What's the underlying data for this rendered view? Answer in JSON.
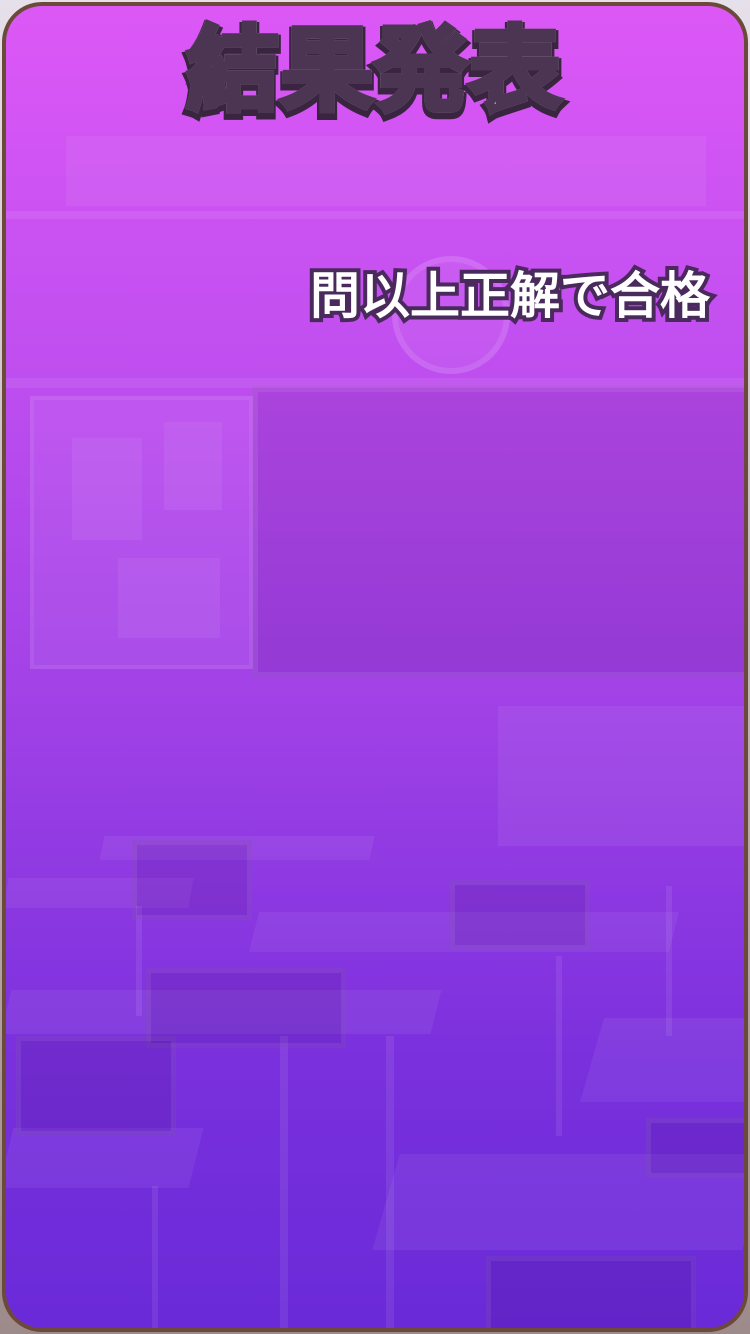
{
  "screen": {
    "title": "結果発表",
    "pass_rule": "問以上正解で合格"
  },
  "colors": {
    "panel_top": "#dc58f6",
    "panel_bottom": "#6a2ad8",
    "frame": "#6b4a3a",
    "title_outline": "#4b3552",
    "rule_outline": "#4a2a5c"
  }
}
